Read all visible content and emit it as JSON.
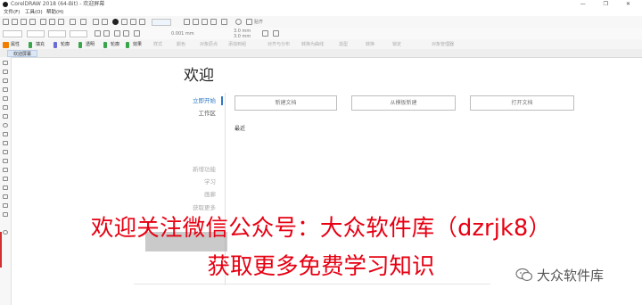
{
  "window": {
    "title": "CorelDRAW 2018 (64-Bit) - 欢迎屏幕",
    "controls": "— ❐ ✕"
  },
  "menu": {
    "items": [
      "文件(F)",
      "工具(O)",
      "帮助(H)"
    ]
  },
  "toolbar": {
    "zoom_value": "",
    "snap_label": "贴齐",
    "x_value": "",
    "y_value": "",
    "width_value": "3.0 mm",
    "height_value": "3.0 mm",
    "nudge_value": "0.001 mm"
  },
  "toolbar3": {
    "items": [
      "属性",
      "填充",
      "轮廓",
      "透明",
      "轮廓",
      "效果"
    ],
    "greyed": [
      "样式",
      "颜色",
      "对象原点",
      "添加到组",
      "对齐与分布",
      "转换为曲线",
      "造型",
      "转换",
      "锁定",
      "对象管理器"
    ]
  },
  "doc_tab": {
    "label": "欢迎屏幕"
  },
  "welcome": {
    "title": "欢迎",
    "sidebar": {
      "get_started": "立即开始",
      "workspace": "工作区",
      "whats_new": "新增功能",
      "learning": "学习",
      "gallery": "画廊",
      "get_more": "获取更多"
    },
    "buttons": {
      "new_doc": "新建文档",
      "from_template": "从模板新建",
      "open_doc": "打开文档"
    },
    "recent_label": "最近"
  },
  "overlay": {
    "line1": "欢迎关注微信公众号：大众软件库（dzrjk8）",
    "line2": "获取更多免费学习知识"
  },
  "watermark": {
    "text": "大众软件库"
  },
  "colors": {
    "accent": "#2f78c4",
    "overlay_red": "#e60012"
  }
}
